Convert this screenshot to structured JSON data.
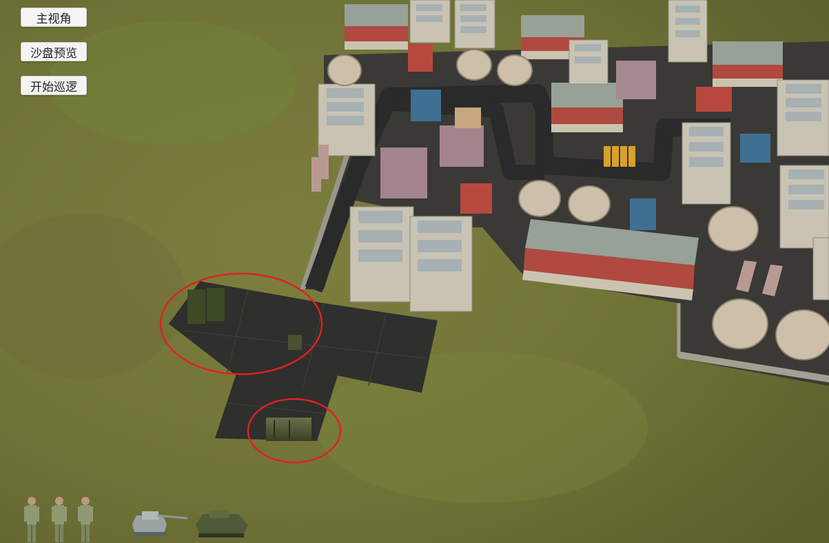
{
  "menu": {
    "main_view_label": "主视角",
    "sandbox_preview_label": "沙盘预览",
    "start_patrol_label": "开始巡逻"
  },
  "units": [
    {
      "type": "soldier",
      "icon": "soldier-icon"
    },
    {
      "type": "soldier",
      "icon": "soldier-icon"
    },
    {
      "type": "soldier",
      "icon": "soldier-icon"
    },
    {
      "type": "self-propelled-gun",
      "icon": "artillery-vehicle-icon"
    },
    {
      "type": "tank",
      "icon": "tank-icon"
    }
  ],
  "colors": {
    "grass": "#7a7a3c",
    "grass_dark": "#5e6130",
    "concrete": "#3b3a36",
    "highlight_ring": "#e02020",
    "roof_gray": "#9aa39a",
    "wall_red": "#b0493f",
    "button_bg": "#f4f4f4"
  }
}
